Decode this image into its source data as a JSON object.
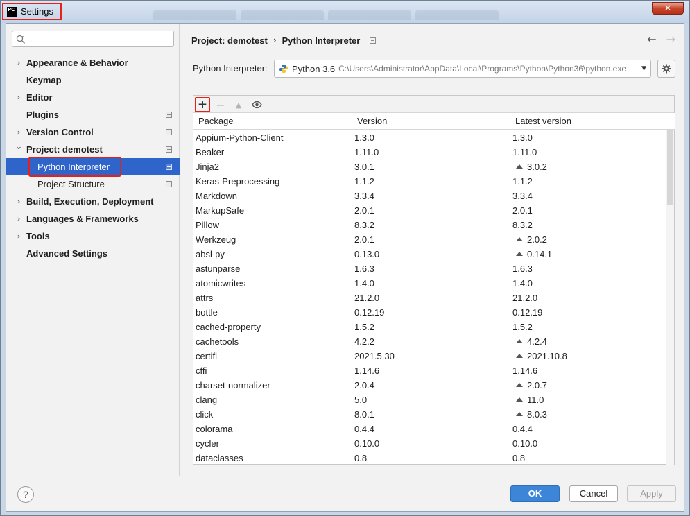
{
  "window": {
    "title": "Settings",
    "close_label": "✕"
  },
  "sidebar": {
    "search_placeholder": "",
    "items": [
      {
        "label": "Appearance & Behavior",
        "expandable": true
      },
      {
        "label": "Keymap",
        "expandable": false
      },
      {
        "label": "Editor",
        "expandable": true
      },
      {
        "label": "Plugins",
        "expandable": false,
        "has_mark": true
      },
      {
        "label": "Version Control",
        "expandable": true,
        "has_mark": true
      },
      {
        "label": "Project: demotest",
        "expandable": true,
        "expanded": true,
        "has_mark": true
      },
      {
        "label": "Python Interpreter",
        "child": true,
        "selected": true,
        "has_mark": true
      },
      {
        "label": "Project Structure",
        "child": true,
        "has_mark": true
      },
      {
        "label": "Build, Execution, Deployment",
        "expandable": true
      },
      {
        "label": "Languages & Frameworks",
        "expandable": true
      },
      {
        "label": "Tools",
        "expandable": true
      },
      {
        "label": "Advanced Settings",
        "expandable": false
      }
    ]
  },
  "header": {
    "breadcrumb_project": "Project: demotest",
    "breadcrumb_page": "Python Interpreter"
  },
  "interpreter": {
    "label": "Python Interpreter:",
    "version": "Python 3.6",
    "path": "C:\\Users\\Administrator\\AppData\\Local\\Programs\\Python\\Python36\\python.exe"
  },
  "table": {
    "headers": [
      "Package",
      "Version",
      "Latest version"
    ],
    "rows": [
      {
        "package": "Appium-Python-Client",
        "version": "1.3.0",
        "latest": "1.3.0",
        "upgrade": false
      },
      {
        "package": "Beaker",
        "version": "1.11.0",
        "latest": "1.11.0",
        "upgrade": false
      },
      {
        "package": "Jinja2",
        "version": "3.0.1",
        "latest": "3.0.2",
        "upgrade": true
      },
      {
        "package": "Keras-Preprocessing",
        "version": "1.1.2",
        "latest": "1.1.2",
        "upgrade": false
      },
      {
        "package": "Markdown",
        "version": "3.3.4",
        "latest": "3.3.4",
        "upgrade": false
      },
      {
        "package": "MarkupSafe",
        "version": "2.0.1",
        "latest": "2.0.1",
        "upgrade": false
      },
      {
        "package": "Pillow",
        "version": "8.3.2",
        "latest": "8.3.2",
        "upgrade": false
      },
      {
        "package": "Werkzeug",
        "version": "2.0.1",
        "latest": "2.0.2",
        "upgrade": true
      },
      {
        "package": "absl-py",
        "version": "0.13.0",
        "latest": "0.14.1",
        "upgrade": true
      },
      {
        "package": "astunparse",
        "version": "1.6.3",
        "latest": "1.6.3",
        "upgrade": false
      },
      {
        "package": "atomicwrites",
        "version": "1.4.0",
        "latest": "1.4.0",
        "upgrade": false
      },
      {
        "package": "attrs",
        "version": "21.2.0",
        "latest": "21.2.0",
        "upgrade": false
      },
      {
        "package": "bottle",
        "version": "0.12.19",
        "latest": "0.12.19",
        "upgrade": false
      },
      {
        "package": "cached-property",
        "version": "1.5.2",
        "latest": "1.5.2",
        "upgrade": false
      },
      {
        "package": "cachetools",
        "version": "4.2.2",
        "latest": "4.2.4",
        "upgrade": true
      },
      {
        "package": "certifi",
        "version": "2021.5.30",
        "latest": "2021.10.8",
        "upgrade": true
      },
      {
        "package": "cffi",
        "version": "1.14.6",
        "latest": "1.14.6",
        "upgrade": false
      },
      {
        "package": "charset-normalizer",
        "version": "2.0.4",
        "latest": "2.0.7",
        "upgrade": true
      },
      {
        "package": "clang",
        "version": "5.0",
        "latest": "11.0",
        "upgrade": true
      },
      {
        "package": "click",
        "version": "8.0.1",
        "latest": "8.0.3",
        "upgrade": true
      },
      {
        "package": "colorama",
        "version": "0.4.4",
        "latest": "0.4.4",
        "upgrade": false
      },
      {
        "package": "cycler",
        "version": "0.10.0",
        "latest": "0.10.0",
        "upgrade": false
      },
      {
        "package": "dataclasses",
        "version": "0.8",
        "latest": "0.8",
        "upgrade": false
      }
    ]
  },
  "footer": {
    "help_label": "?",
    "ok_label": "OK",
    "cancel_label": "Cancel",
    "apply_label": "Apply"
  },
  "colors": {
    "selection": "#2f65ca",
    "ok_button": "#3d85d6",
    "annotation_red": "#e8201a"
  }
}
